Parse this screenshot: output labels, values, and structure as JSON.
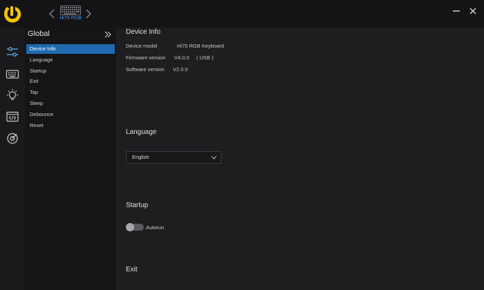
{
  "titlebar": {
    "device_name": "Hi75 RGB",
    "icons": {
      "logo": "brand-logo-icon",
      "prev": "chevron-left-icon",
      "next": "chevron-right-icon",
      "minimize": "minimize-icon",
      "close": "close-icon"
    }
  },
  "rail": {
    "items": [
      "sliders-icon",
      "keyboard-icon",
      "lighting-bulb-icon",
      "macro-code-icon",
      "target-icon"
    ]
  },
  "subnav": {
    "title": "Global",
    "items": [
      {
        "label": "Device Info",
        "active": true
      },
      {
        "label": "Language"
      },
      {
        "label": "Startup"
      },
      {
        "label": "Exit"
      },
      {
        "label": "Tap"
      },
      {
        "label": "Sleep"
      },
      {
        "label": "Debounce"
      },
      {
        "label": "Reset"
      }
    ]
  },
  "device_info": {
    "title": "Device Info",
    "model_label": "Device model",
    "model_value": "Hi75 RGB Keyboard",
    "firmware_label": "Firmware version",
    "firmware_value": "V4.0.0",
    "firmware_conn": "( USB )",
    "software_label": "Software version",
    "software_value": "V2.0.0"
  },
  "language": {
    "title": "Language",
    "selected": "English"
  },
  "startup": {
    "title": "Startup",
    "toggle_label": "Autorun",
    "enabled": false
  },
  "exit": {
    "title": "Exit"
  },
  "colors": {
    "accent": "#1f6ab0",
    "logo_yellow": "#f5c400",
    "rail_icon": "#5aa9e6",
    "device_label": "#3b9bf0"
  }
}
